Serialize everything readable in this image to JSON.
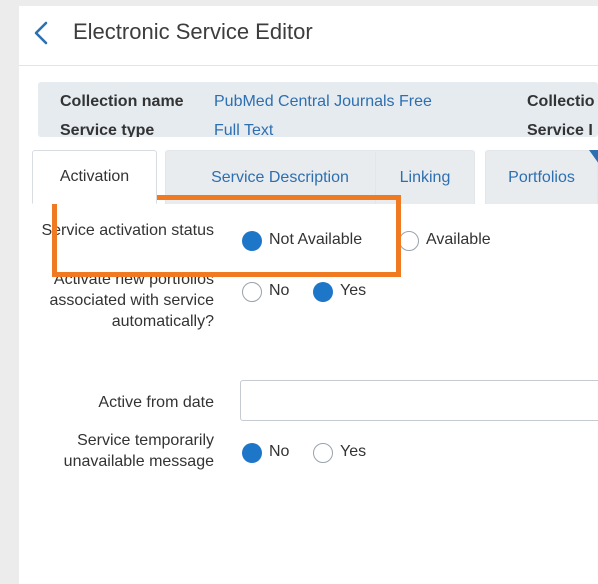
{
  "header": {
    "title": "Electronic Service Editor",
    "back_icon": "chevron-left-icon"
  },
  "summary": {
    "collection_name_label": "Collection name",
    "collection_name_value": "PubMed Central Journals Free",
    "collection_label_truncated": "Collectio",
    "service_type_label": "Service type",
    "service_type_value": "Full Text",
    "service_label_truncated": "Service I"
  },
  "tabs": [
    "Activation",
    "Service Description",
    "Linking",
    "Portfolios"
  ],
  "active_tab": "Activation",
  "form": {
    "activation_status": {
      "label": "Service activation status",
      "options": [
        "Not Available",
        "Available"
      ],
      "selected": "Not Available"
    },
    "activate_new_portfolios": {
      "label": "Activate new portfolios associated with service automatically?",
      "options": [
        "No",
        "Yes"
      ],
      "selected": "Yes"
    },
    "active_from_date": {
      "label": "Active from date",
      "value": ""
    },
    "temporarily_unavailable": {
      "label": "Service temporarily unavailable message",
      "options": [
        "No",
        "Yes"
      ],
      "selected": "No"
    }
  },
  "colors": {
    "accent": "#1e76c8",
    "link": "#2d6fb0",
    "highlight": "#f07a22"
  }
}
